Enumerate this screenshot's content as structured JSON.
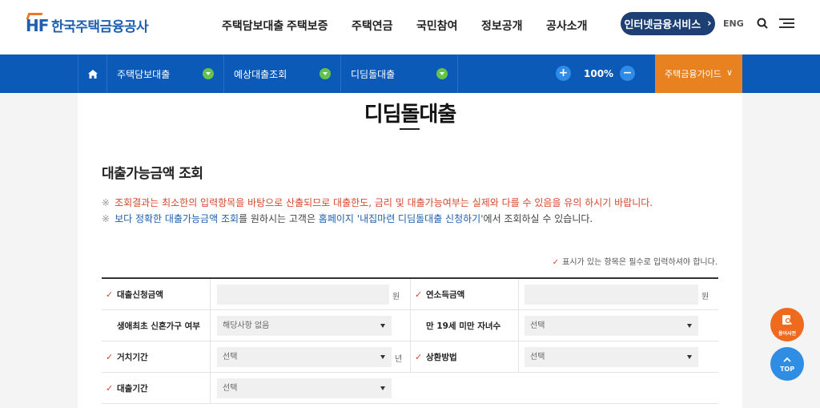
{
  "header": {
    "logo_text": "한국주택금융공사",
    "logo_mark": "HF",
    "menu": [
      "주택담보대출",
      "주택보증",
      "주택연금",
      "국민참여",
      "정보공개",
      "공사소개"
    ],
    "internet_service": "인터넷금융서비스",
    "language": "ENG"
  },
  "navbar": {
    "crumbs": [
      "주택담보대출",
      "예상대출조회",
      "디딤돌대출"
    ],
    "zoom": "100%",
    "zoom_in": "+",
    "zoom_out": "−",
    "guide": "주택금융가이드"
  },
  "main": {
    "title": "디딤돌대출",
    "section_title": "대출가능금액 조회",
    "note1": "조회결과는 최소한의 입력항목을 바탕으로 산출되므로 대출한도, 금리 및 대출가능여부는 실제와 다를 수 있음을 유의 하시기 바랍니다.",
    "note2_a": "보다 정확한 대출가능금액 조회",
    "note2_b": "를 원하시는 고객은 ",
    "note2_c": "홈페이지 '내집마련 디딤돌대출 신청하기'",
    "note2_d": "에서 조회하실 수 있습니다.",
    "note_mark": "※",
    "required_note": "표시가 있는 항목은 필수로 입력하셔야 합니다."
  },
  "form": {
    "loan_amount_label": "대출신청금액",
    "income_label": "연소득금액",
    "won": "원",
    "newlywed_label": "생애최초 신혼가구 여부",
    "newlywed_value": "해당사항 없음",
    "children_label": "만 19세 미만 자녀수",
    "select": "선택",
    "grace_label": "거치기간",
    "year": "년",
    "repay_label": "상환방법",
    "term_label": "대출기간"
  },
  "floating": {
    "dictionary": "용어사전",
    "top": "TOP"
  },
  "colors": {
    "nav_blue": "#0b5ab8",
    "guide_orange": "#e8811f",
    "warning_red": "#d9452b"
  }
}
